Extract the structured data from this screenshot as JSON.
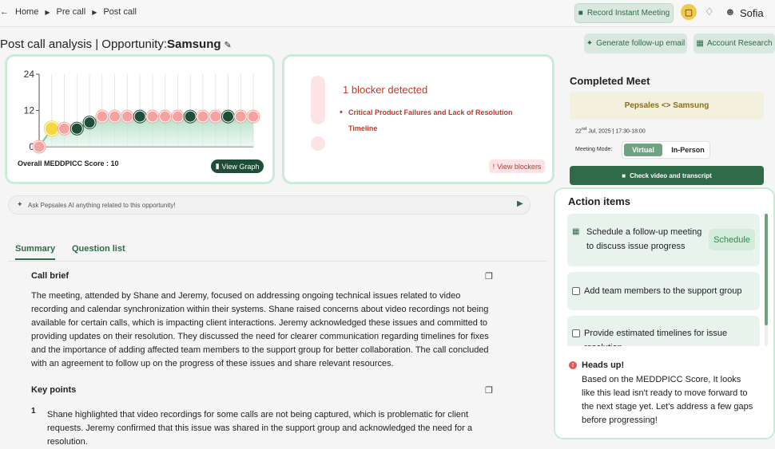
{
  "topbar": {
    "crumbs": [
      "Home",
      "Pre call",
      "Post call"
    ],
    "record_label": "Record Instant Meeting",
    "user_name": "Sofia"
  },
  "page": {
    "title_prefix": "Post call analysis | Opportunity:",
    "opportunity": "Samsung",
    "generate_label": "Generate follow-up email",
    "account_label": "Account Research"
  },
  "score": {
    "label": "Overall MEDDPICC Score : 10",
    "view_graph_label": "View Graph",
    "chart_data": {
      "type": "line",
      "y_ticks": [
        "24",
        "12",
        "0"
      ],
      "ylim": [
        0,
        24
      ],
      "values": [
        0,
        6,
        6,
        6,
        8,
        10,
        10,
        10,
        10,
        10,
        10,
        10,
        10,
        10,
        10,
        10,
        10,
        10
      ],
      "point_status": [
        "red",
        "yellow",
        "red",
        "dark",
        "dark",
        "red",
        "red",
        "red",
        "dark",
        "red",
        "red",
        "red",
        "dark",
        "red",
        "red",
        "dark",
        "red",
        "red"
      ],
      "colors": {
        "red": "#f4a3a0",
        "yellow": "#f5d742",
        "dark": "#1f4d36",
        "line": "#7fc7a0"
      }
    }
  },
  "blocker": {
    "title": "1 blocker detected",
    "item": "Critical Product Failures and Lack of Resolution Timeline",
    "view_label": "View blockers"
  },
  "ask": {
    "placeholder": "Ask Pepsales AI anything related to this opportunity!"
  },
  "tabs": {
    "summary": "Summary",
    "questions": "Question list"
  },
  "call_brief": {
    "heading": "Call brief",
    "text": "The meeting, attended by Shane and Jeremy, focused on addressing ongoing technical issues related to video recording and calendar synchronization within their systems. Shane raised concerns about video recordings not being available for certain calls, which is impacting client interactions. Jeremy acknowledged these issues and committed to providing updates on their resolution. They discussed the need for clearer communication regarding timelines for fixes and the importance of adding affected team members to the support group for better collaboration. The call concluded with an agreement to follow up on the progress of these issues and share relevant resources."
  },
  "key_points": {
    "heading": "Key points",
    "num": "1",
    "text": "Shane highlighted that video recordings for some calls are not being captured, which is problematic for client requests. Jeremy confirmed that this issue was shared in the support group and acknowledged the need for a resolution."
  },
  "completed": {
    "heading": "Completed Meet",
    "meeting_name": "Pepsales <> Samsung",
    "date_day": "22",
    "date_sup": "nd",
    "date_rest": " Jul, 2025 | 17:30-18:00",
    "mode_label": "Meeting Mode:",
    "mode_virtual": "Virtual",
    "mode_inperson": "In-Person",
    "check_video_label": "Check video and transcript"
  },
  "actions": {
    "heading": "Action items",
    "items": [
      "Schedule a follow-up meeting to discuss issue progress",
      "Add team members to the support group",
      "Provide estimated timelines for issue resolution"
    ],
    "schedule_label": "Schedule",
    "heads_up_title": "Heads up!",
    "heads_up_text": "Based on the MEDDPICC Score, It looks like this lead isn't ready to move forward to the next stage yet. Let's address a few gaps before progressing!"
  }
}
